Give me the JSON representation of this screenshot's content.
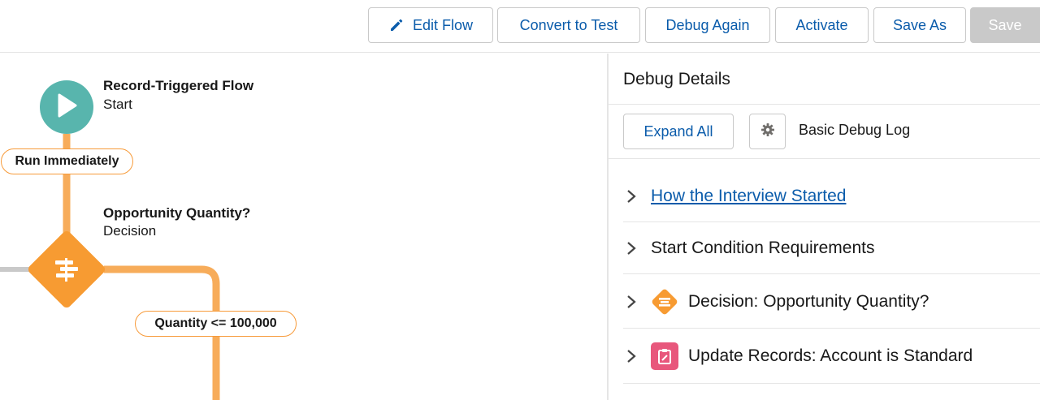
{
  "toolbar": {
    "edit_flow": "Edit Flow",
    "convert_to_test": "Convert to Test",
    "debug_again": "Debug Again",
    "activate": "Activate",
    "save_as": "Save As",
    "save": "Save"
  },
  "canvas": {
    "start": {
      "title": "Record-Triggered Flow",
      "subtitle": "Start",
      "icon": "play-icon"
    },
    "run_path": "Run Immediately",
    "decision": {
      "title": "Opportunity Quantity?",
      "subtitle": "Decision",
      "icon": "decision-icon"
    },
    "outcome": "Quantity <= 100,000"
  },
  "debug_panel": {
    "title": "Debug Details",
    "expand_all": "Expand All",
    "log_level": "Basic Debug Log",
    "sections": [
      {
        "label": "How the Interview Started",
        "link": true
      },
      {
        "label": "Start Condition Requirements"
      },
      {
        "label": "Decision: Opportunity Quantity?",
        "icon": "decision-icon"
      },
      {
        "label": "Update Records: Account is Standard",
        "icon": "update-records-icon"
      }
    ]
  },
  "colors": {
    "accent_blue": "#0b5cab",
    "connector_orange": "#f7ac5a",
    "start_teal": "#58b5ad",
    "decision_orange": "#f79b32",
    "update_pink": "#e8577c",
    "disabled_gray": "#c9c9c9"
  }
}
